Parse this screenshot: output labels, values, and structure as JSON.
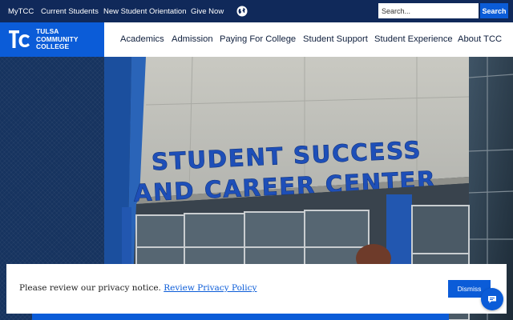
{
  "utility_nav": {
    "links": [
      "MyTCC",
      "Current Students",
      "New Student Orientation",
      "Give Now"
    ],
    "globe_icon": "globe-icon"
  },
  "search": {
    "placeholder": "Search...",
    "button_label": "Search"
  },
  "logo": {
    "monogram": "TCC",
    "line1": "TULSA",
    "line2": "COMMUNITY",
    "line3": "COLLEGE"
  },
  "main_nav": [
    "Academics",
    "Admission",
    "Paying For College",
    "Student Support",
    "Student Experience",
    "About TCC"
  ],
  "hero": {
    "sign_line1": "STUDENT SUCCESS",
    "sign_line2": "AND CAREER CENTER"
  },
  "privacy_banner": {
    "text": "Please review our privacy notice.",
    "link_label": "Review Privacy Policy",
    "dismiss_label": "Dismiss"
  },
  "chat": {
    "icon": "chat-bubble-icon"
  },
  "colors": {
    "brand_blue": "#0b5cd8",
    "top_bar": "#10295a",
    "sidebar": "#16335f",
    "nav_text": "#0f1f3d",
    "sign_letters": "#1e4fb8"
  }
}
